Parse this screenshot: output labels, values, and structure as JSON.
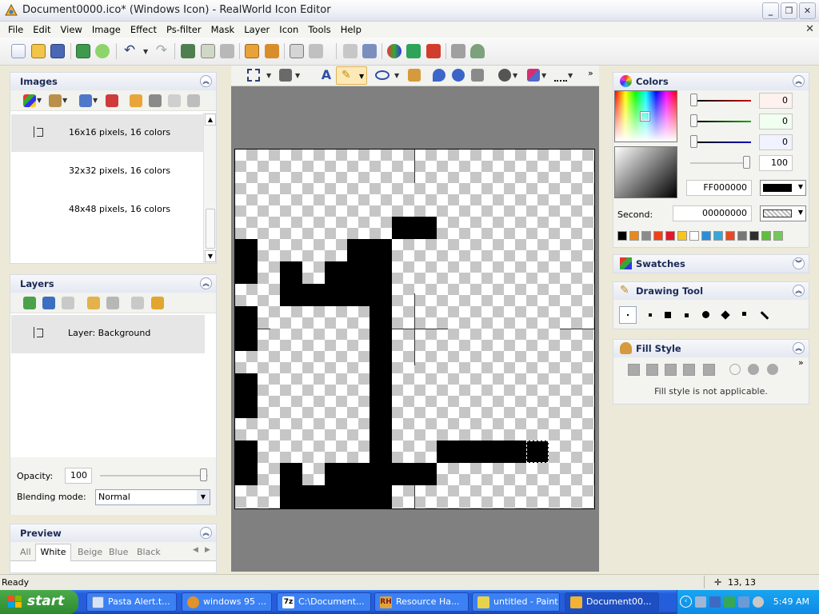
{
  "window": {
    "title": "Document0000.ico* (Windows Icon) - RealWorld Icon Editor",
    "app_icon": "realworld-icon",
    "controls": [
      "minimize",
      "restore",
      "close"
    ]
  },
  "menu": [
    "File",
    "Edit",
    "View",
    "Image",
    "Effect",
    "Ps-filter",
    "Mask",
    "Layer",
    "Icon",
    "Tools",
    "Help"
  ],
  "images_panel": {
    "title": "Images",
    "items": [
      {
        "label": "16x16 pixels, 16 colors",
        "selected": true
      },
      {
        "label": "32x32 pixels, 16 colors",
        "selected": false
      },
      {
        "label": "48x48 pixels, 16 colors",
        "selected": false
      }
    ]
  },
  "layers_panel": {
    "title": "Layers",
    "items": [
      {
        "label": "Layer: Background"
      }
    ],
    "opacity_label": "Opacity:",
    "opacity_value": "100",
    "blend_label": "Blending mode:",
    "blend_value": "Normal"
  },
  "preview_panel": {
    "title": "Preview",
    "tabs": [
      "All",
      "White",
      "Beige",
      "Blue",
      "Black"
    ],
    "active_tab": "White"
  },
  "colors_panel": {
    "title": "Colors",
    "red": "0",
    "green": "0",
    "blue": "0",
    "alpha": "100",
    "primary_hex": "FF000000",
    "second_label": "Second:",
    "second_hex": "00000000",
    "palette": [
      "#000000",
      "#e8891b",
      "#8c8c8c",
      "#f0421a",
      "#e3162a",
      "#f7c51e",
      "#ffffff",
      "#2a8fd8",
      "#38a7d6",
      "#e84a24",
      "#777777",
      "#2e2e2e",
      "#5fbf3c",
      "#78c55a"
    ]
  },
  "swatches_panel": {
    "title": "Swatches"
  },
  "drawing_tool_panel": {
    "title": "Drawing Tool"
  },
  "fill_style_panel": {
    "title": "Fill Style",
    "message": "Fill style is not applicable."
  },
  "status": {
    "text": "Ready",
    "coords": "13, 13"
  },
  "taskbar": {
    "start": "start",
    "tasks": [
      {
        "label": "Pasta Alert.t...",
        "icon": "notepad-icon",
        "active": false
      },
      {
        "label": "windows 95 ...",
        "icon": "browser-icon",
        "active": false
      },
      {
        "label": "C:\\Document...",
        "icon": "7zip-icon",
        "active": false
      },
      {
        "label": "Resource Ha...",
        "icon": "resource-hacker-icon",
        "active": false
      },
      {
        "label": "untitled - Paint",
        "icon": "paint-icon",
        "active": false
      },
      {
        "label": "Document00...",
        "icon": "icon-editor-icon",
        "active": true
      }
    ],
    "clock": "5:49 AM"
  }
}
